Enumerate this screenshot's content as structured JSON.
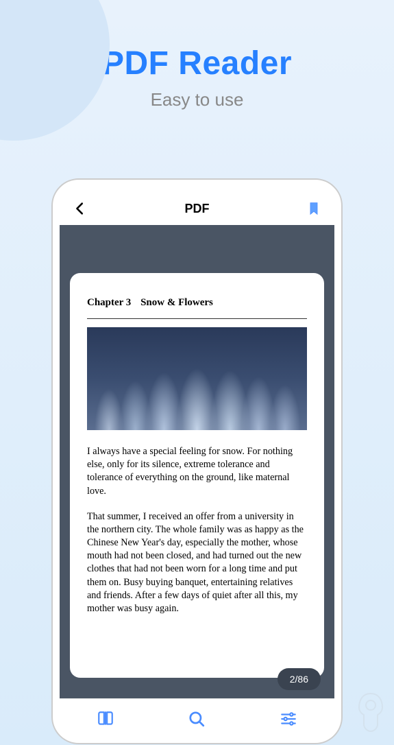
{
  "hero": {
    "title": "PDF Reader",
    "subtitle": "Easy to use"
  },
  "app": {
    "header_title": "PDF",
    "page_indicator": "2/86"
  },
  "document": {
    "chapter_label": "Chapter 3",
    "chapter_title": "Snow & Flowers",
    "paragraph1": "I always have a special feeling for snow. For nothing else, only for its silence, extreme tolerance and tolerance of everything on the ground, like maternal love.",
    "paragraph2": "That summer, I received an offer from a university in the northern city. The whole family was as happy as the Chinese New Year's day, especially the mother, whose mouth had not been closed, and had turned out the new clothes that had not been worn for a long time and put them on. Busy buying banquet, entertaining relatives and friends. After a few days of quiet after all this, my mother was busy again."
  },
  "icons": {
    "back": "back-arrow-icon",
    "bookmark": "bookmark-icon",
    "book": "book-icon",
    "search": "search-icon",
    "settings": "settings-sliders-icon"
  },
  "colors": {
    "accent": "#4a8cff",
    "title": "#2680ff",
    "viewer_bg": "#4a5564"
  }
}
